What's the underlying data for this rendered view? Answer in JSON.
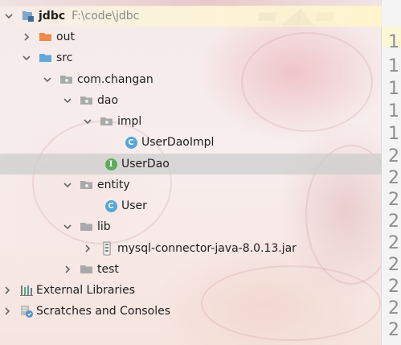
{
  "project_tree": {
    "project": {
      "name": "jdbc",
      "path": "F:\\code\\jdbc",
      "icon": "module-folder-icon"
    },
    "nodes": [
      {
        "label": "out",
        "icon": "excluded-folder-icon",
        "expanded": false
      },
      {
        "label": "src",
        "icon": "source-folder-icon",
        "expanded": true
      },
      {
        "label": "com.changan",
        "icon": "package-icon",
        "expanded": true
      },
      {
        "label": "dao",
        "icon": "package-icon",
        "expanded": true
      },
      {
        "label": "impl",
        "icon": "package-icon",
        "expanded": true
      },
      {
        "label": "UserDaoImpl",
        "icon": "class-icon",
        "badge": "C"
      },
      {
        "label": "UserDao",
        "icon": "interface-icon",
        "badge": "I",
        "selected": true
      },
      {
        "label": "entity",
        "icon": "package-icon",
        "expanded": true
      },
      {
        "label": "User",
        "icon": "class-icon",
        "badge": "C"
      },
      {
        "label": "lib",
        "icon": "folder-icon",
        "expanded": true
      },
      {
        "label": "mysql-connector-java-8.0.13.jar",
        "icon": "jar-icon",
        "expanded": false
      },
      {
        "label": "test",
        "icon": "folder-icon",
        "expanded": false
      },
      {
        "label": "External Libraries",
        "icon": "external-libraries-icon",
        "expanded": false
      },
      {
        "label": "Scratches and Consoles",
        "icon": "scratches-icon",
        "expanded": false
      }
    ]
  },
  "gutter": {
    "line_numbers": [
      "1",
      "1",
      "1",
      "1",
      "1",
      "2",
      "2",
      "2",
      "2",
      "2",
      "2",
      "2",
      "2",
      "2",
      "2",
      "2",
      "2"
    ]
  },
  "colors": {
    "selection": "#cdcdcd",
    "class_badge": "#54a7d7",
    "interface_badge": "#5aae5a",
    "excluded_folder": "#f0894c",
    "source_folder": "#62a8d8",
    "path_text": "#8a8a8a"
  }
}
